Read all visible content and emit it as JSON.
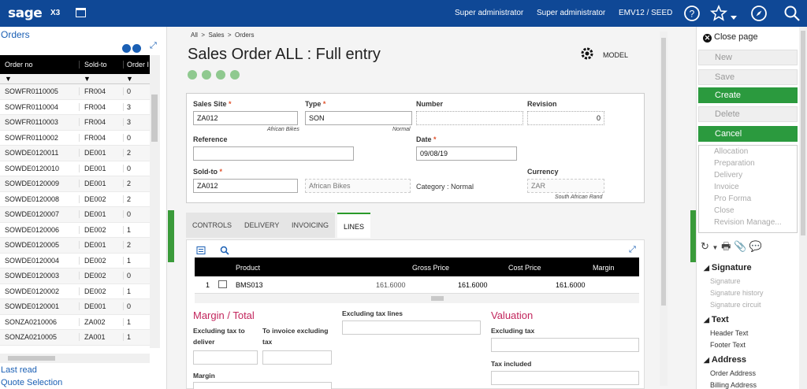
{
  "topbar": {
    "logo": "sage",
    "app": "X3",
    "user1": "Super administrator",
    "user2": "Super administrator",
    "folder": "EMV12 / SEED"
  },
  "left": {
    "title": "Orders",
    "columns": [
      "Order no",
      "Sold-to",
      "Order I"
    ],
    "rows": [
      [
        "SOWFR0110005",
        "FR004",
        "0"
      ],
      [
        "SOWFR0110004",
        "FR004",
        "3"
      ],
      [
        "SOWFR0110003",
        "FR004",
        "3"
      ],
      [
        "SOWFR0110002",
        "FR004",
        "0"
      ],
      [
        "SOWDE0120011",
        "DE001",
        "2"
      ],
      [
        "SOWDE0120010",
        "DE001",
        "0"
      ],
      [
        "SOWDE0120009",
        "DE001",
        "2"
      ],
      [
        "SOWDE0120008",
        "DE002",
        "2"
      ],
      [
        "SOWDE0120007",
        "DE001",
        "0"
      ],
      [
        "SOWDE0120006",
        "DE002",
        "1"
      ],
      [
        "SOWDE0120005",
        "DE001",
        "2"
      ],
      [
        "SOWDE0120004",
        "DE002",
        "1"
      ],
      [
        "SOWDE0120003",
        "DE002",
        "0"
      ],
      [
        "SOWDE0120002",
        "DE002",
        "1"
      ],
      [
        "SOWDE0120001",
        "DE001",
        "0"
      ],
      [
        "SONZA0210006",
        "ZA002",
        "1"
      ],
      [
        "SONZA0210005",
        "ZA001",
        "1"
      ]
    ],
    "last_read": "Last read",
    "quote_selection": "Quote Selection"
  },
  "center": {
    "breadcrumb": [
      "All",
      "Sales",
      "Orders"
    ],
    "title": "Sales Order ALL : Full entry",
    "model_label": "MODEL",
    "header": {
      "sales_site_label": "Sales Site",
      "sales_site": "ZA012",
      "sales_site_desc": "African Bikes",
      "type_label": "Type",
      "type": "SON",
      "type_desc": "Normal",
      "number_label": "Number",
      "number": "",
      "revision_label": "Revision",
      "revision": "0",
      "reference_label": "Reference",
      "reference": "",
      "date_label": "Date",
      "date": "09/08/19",
      "soldto_label": "Sold-to",
      "soldto": "ZA012",
      "soldto_name": "African Bikes",
      "category_text": "Category : Normal",
      "currency_label": "Currency",
      "currency": "ZAR",
      "currency_desc": "South African Rand"
    },
    "tabs": [
      "CONTROLS",
      "DELIVERY",
      "INVOICING",
      "LINES"
    ],
    "lines": {
      "columns": [
        "Product",
        "Gross Price",
        "Cost Price",
        "Margin"
      ],
      "rows": [
        {
          "num": "1",
          "product": "BMS013",
          "price1": "161.6000",
          "gross": "161.6000",
          "cost": "161.6000"
        }
      ]
    },
    "margin_total_title": "Margin / Total",
    "valuation_title": "Valuation",
    "excl_tax_deliver": "Excluding tax to deliver",
    "to_invoice_excl": "To invoice excluding tax",
    "excl_tax_lines": "Excluding tax lines",
    "excluding_tax": "Excluding tax",
    "margin": "Margin",
    "tax_included": "Tax included"
  },
  "right": {
    "close_page": "Close page",
    "buttons": [
      "New",
      "Save",
      "Create",
      "Delete",
      "Cancel"
    ],
    "actions": [
      "Allocation",
      "Preparation",
      "Delivery",
      "Invoice",
      "Pro Forma",
      "Close",
      "Revision Manage..."
    ],
    "sections": [
      {
        "title": "Signature",
        "items": [
          "Signature",
          "Signature history",
          "Signature circuit"
        ]
      },
      {
        "title": "Text",
        "items": [
          "Header Text",
          "Footer Text"
        ]
      },
      {
        "title": "Address",
        "items": [
          "Order Address",
          "Billing Address"
        ]
      }
    ]
  },
  "colors": {
    "topbar": "#0f4896",
    "accent_green": "#2b9a3e",
    "link_blue": "#1a5fb4",
    "section_pink": "#c2255c"
  }
}
